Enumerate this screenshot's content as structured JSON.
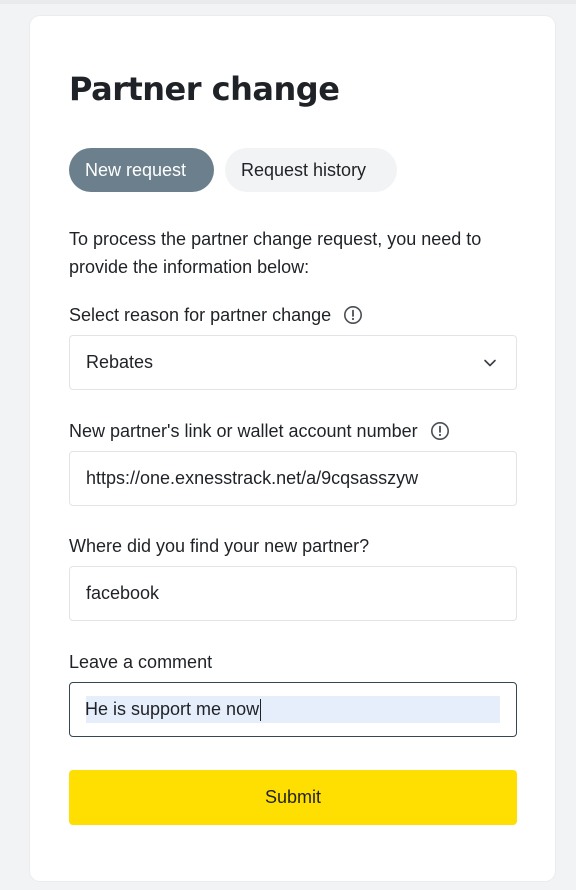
{
  "page": {
    "title": "Partner change"
  },
  "tabs": [
    {
      "label": "New request",
      "active": true
    },
    {
      "label": "Request history",
      "active": false
    }
  ],
  "intro": "To process the partner change request, you need to provide the information below:",
  "form": {
    "reason": {
      "label": "Select reason for partner change",
      "value": "Rebates",
      "icon": "info-icon"
    },
    "partner_link": {
      "label": "New partner's link or wallet account number",
      "value": "https://one.exnesstrack.net/a/9cqsasszyw",
      "icon": "info-icon"
    },
    "source": {
      "label": "Where did you find your new partner?",
      "value": "facebook"
    },
    "comment": {
      "label": "Leave a comment",
      "value": "He is support me now"
    },
    "submit_label": "Submit"
  },
  "colors": {
    "accent": "#ffde02",
    "tab_active_bg": "#6b7f8c",
    "tab_inactive_bg": "#f2f3f4",
    "text": "#1f2226",
    "selection": "#e6eefb"
  }
}
